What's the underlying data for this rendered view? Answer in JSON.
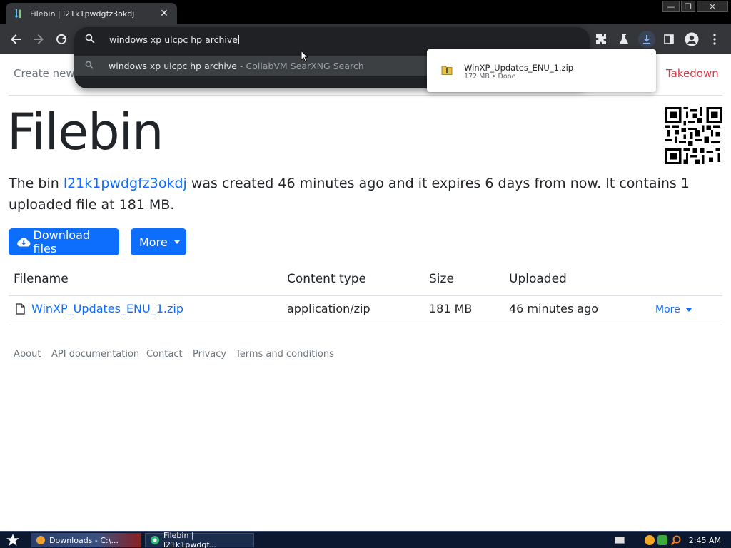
{
  "browser": {
    "tab_title": "Filebin | l21k1pwdgfz3okdj",
    "tab_close": "✕",
    "window_controls": [
      "—",
      "❐",
      "✕"
    ],
    "omnibox_text": "windows xp ulcpc hp archive",
    "suggestion_query": "windows xp ulcpc hp archive",
    "suggestion_source": "- CollabVM SearXNG Search"
  },
  "download": {
    "filename": "WinXP_Updates_ENU_1.zip",
    "status": "172 MB • Done"
  },
  "page": {
    "nav_create": "Create new",
    "nav_takedown": "Takedown",
    "title": "Filebin",
    "desc_prefix": "The bin ",
    "bin_id": "l21k1pwdgfz3okdj",
    "desc_suffix": " was created 46 minutes ago and it expires 6 days from now. It contains 1 uploaded file at 181 MB.",
    "download_button": "Download files",
    "more_button": "More",
    "columns": {
      "filename": "Filename",
      "content_type": "Content type",
      "size": "Size",
      "uploaded": "Uploaded"
    },
    "file_row": {
      "filename": "WinXP_Updates_ENU_1.zip",
      "content_type": "application/zip",
      "size": "181 MB",
      "uploaded": "46 minutes ago",
      "more": "More"
    },
    "footer": {
      "about": "About",
      "api": "API documentation",
      "contact": "Contact",
      "privacy": "Privacy",
      "terms": "Terms and conditions"
    }
  },
  "taskbar": {
    "task1": "Downloads - C:\\...",
    "task2": "Filebin | l21k1pwdgf...",
    "clock": "2:45 AM"
  },
  "colors": {
    "accent": "#0d6efd",
    "danger": "#dc3545",
    "browser_frame": "#35363a",
    "omnibox": "#202124"
  }
}
